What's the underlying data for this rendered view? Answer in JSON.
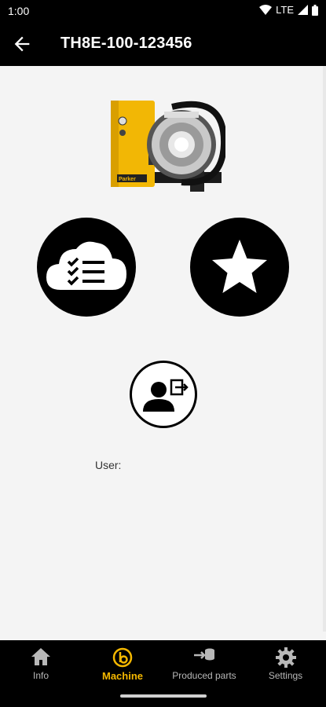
{
  "status": {
    "time": "1:00",
    "network": "LTE"
  },
  "appbar": {
    "title": "TH8E-100-123456"
  },
  "main": {
    "machine_image_alt": "Machine",
    "user_label": "User:"
  },
  "bottom_nav": {
    "items": [
      {
        "label": "Info",
        "icon": "home-icon"
      },
      {
        "label": "Machine",
        "icon": "machine-icon",
        "active": true
      },
      {
        "label": "Produced parts",
        "icon": "produced-parts-icon"
      },
      {
        "label": "Settings",
        "icon": "gear-icon"
      }
    ]
  },
  "colors": {
    "accent": "#f5b800",
    "bar": "#000000",
    "background": "#f4f4f4"
  }
}
